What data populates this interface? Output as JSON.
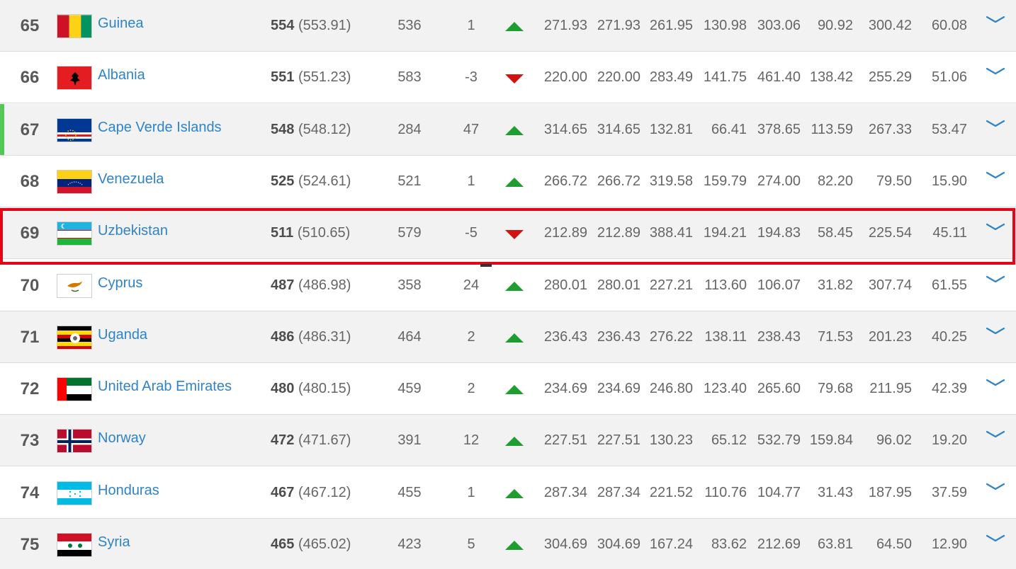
{
  "rows": [
    {
      "rank": "65",
      "team": "Guinea",
      "points": "554",
      "points_exact": "(553.91)",
      "prev": "536",
      "move": "1",
      "dir": "up",
      "flag": "guinea",
      "v": [
        "271.93",
        "271.93",
        "261.95",
        "130.98",
        "303.06",
        "90.92",
        "300.42",
        "60.08"
      ]
    },
    {
      "rank": "66",
      "team": "Albania",
      "points": "551",
      "points_exact": "(551.23)",
      "prev": "583",
      "move": "-3",
      "dir": "down",
      "flag": "albania",
      "v": [
        "220.00",
        "220.00",
        "283.49",
        "141.75",
        "461.40",
        "138.42",
        "255.29",
        "51.06"
      ]
    },
    {
      "rank": "67",
      "team": "Cape Verde Islands",
      "points": "548",
      "points_exact": "(548.12)",
      "prev": "284",
      "move": "47",
      "dir": "up",
      "flag": "capeverde",
      "v": [
        "314.65",
        "314.65",
        "132.81",
        "66.41",
        "378.65",
        "113.59",
        "267.33",
        "53.47"
      ]
    },
    {
      "rank": "68",
      "team": "Venezuela",
      "points": "525",
      "points_exact": "(524.61)",
      "prev": "521",
      "move": "1",
      "dir": "up",
      "flag": "venezuela",
      "v": [
        "266.72",
        "266.72",
        "319.58",
        "159.79",
        "274.00",
        "82.20",
        "79.50",
        "15.90"
      ]
    },
    {
      "rank": "69",
      "team": "Uzbekistan",
      "points": "511",
      "points_exact": "(510.65)",
      "prev": "579",
      "move": "-5",
      "dir": "down",
      "flag": "uzbekistan",
      "v": [
        "212.89",
        "212.89",
        "388.41",
        "194.21",
        "194.83",
        "58.45",
        "225.54",
        "45.11"
      ]
    },
    {
      "rank": "70",
      "team": "Cyprus",
      "points": "487",
      "points_exact": "(486.98)",
      "prev": "358",
      "move": "24",
      "dir": "up",
      "flag": "cyprus",
      "v": [
        "280.01",
        "280.01",
        "227.21",
        "113.60",
        "106.07",
        "31.82",
        "307.74",
        "61.55"
      ]
    },
    {
      "rank": "71",
      "team": "Uganda",
      "points": "486",
      "points_exact": "(486.31)",
      "prev": "464",
      "move": "2",
      "dir": "up",
      "flag": "uganda",
      "v": [
        "236.43",
        "236.43",
        "276.22",
        "138.11",
        "238.43",
        "71.53",
        "201.23",
        "40.25"
      ]
    },
    {
      "rank": "72",
      "team": "United Arab Emirates",
      "points": "480",
      "points_exact": "(480.15)",
      "prev": "459",
      "move": "2",
      "dir": "up",
      "flag": "uae",
      "v": [
        "234.69",
        "234.69",
        "246.80",
        "123.40",
        "265.60",
        "79.68",
        "211.95",
        "42.39"
      ]
    },
    {
      "rank": "73",
      "team": "Norway",
      "points": "472",
      "points_exact": "(471.67)",
      "prev": "391",
      "move": "12",
      "dir": "up",
      "flag": "norway",
      "v": [
        "227.51",
        "227.51",
        "130.23",
        "65.12",
        "532.79",
        "159.84",
        "96.02",
        "19.20"
      ]
    },
    {
      "rank": "74",
      "team": "Honduras",
      "points": "467",
      "points_exact": "(467.12)",
      "prev": "455",
      "move": "1",
      "dir": "up",
      "flag": "honduras",
      "v": [
        "287.34",
        "287.34",
        "221.52",
        "110.76",
        "104.77",
        "31.43",
        "187.95",
        "37.59"
      ]
    },
    {
      "rank": "75",
      "team": "Syria",
      "points": "465",
      "points_exact": "(465.02)",
      "prev": "423",
      "move": "5",
      "dir": "up",
      "flag": "syria",
      "v": [
        "304.69",
        "304.69",
        "167.24",
        "83.62",
        "212.69",
        "63.81",
        "64.50",
        "12.90"
      ]
    }
  ],
  "highlighted_row": "69",
  "colors": {
    "link": "#2f83c9",
    "up": "#1e9e30",
    "down": "#d01313",
    "highlight": "#e3061a",
    "mover_marker": "#55c755"
  }
}
